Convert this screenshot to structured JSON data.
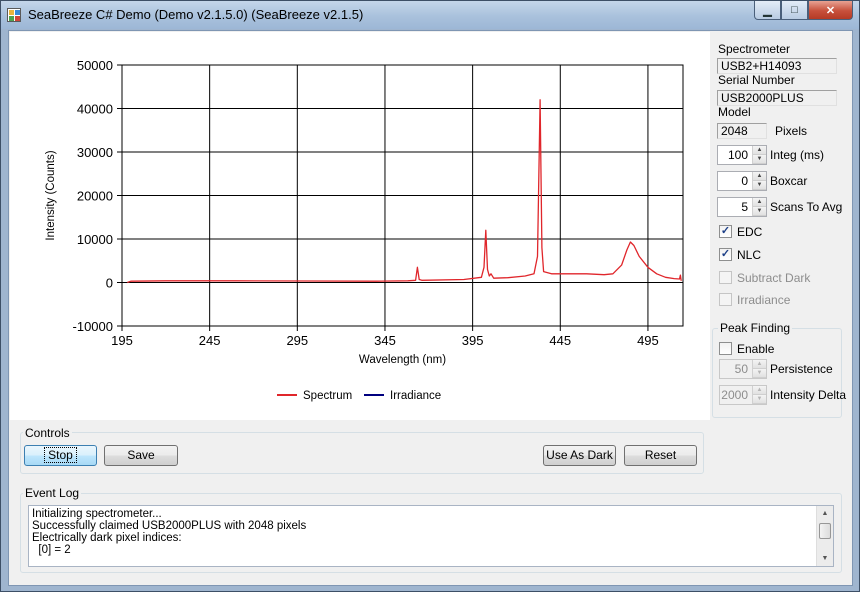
{
  "window": {
    "title": "SeaBreeze C# Demo (Demo v2.1.5.0) (SeaBreeze v2.1.5)",
    "minimize_glyph": "▁",
    "maximize_glyph": "□",
    "close_glyph": "✕"
  },
  "spectrometer": {
    "group_label": "Spectrometer",
    "serial_value": "USB2+H14093",
    "serial_label": "Serial Number",
    "model_value": "USB2000PLUS",
    "model_label": "Model",
    "pixels_value": "2048",
    "pixels_label": "Pixels",
    "integ_value": "100",
    "integ_label": "Integ (ms)",
    "boxcar_value": "0",
    "boxcar_label": "Boxcar",
    "scans_value": "5",
    "scans_label": "Scans To Avg",
    "edc_label": "EDC",
    "edc_checked": true,
    "nlc_label": "NLC",
    "nlc_checked": true,
    "subtract_dark_label": "Subtract Dark",
    "subtract_dark_checked": false,
    "irradiance_label": "Irradiance",
    "irradiance_checked": false
  },
  "peak_finding": {
    "group_label": "Peak Finding",
    "enable_label": "Enable",
    "enable_checked": false,
    "persistence_value": "50",
    "persistence_label": "Persistence",
    "intensity_delta_value": "2000",
    "intensity_delta_label": "Intensity Delta"
  },
  "controls": {
    "group_label": "Controls",
    "stop_label": "Stop",
    "save_label": "Save",
    "use_as_dark_label": "Use As Dark",
    "reset_label": "Reset"
  },
  "event_log": {
    "group_label": "Event Log",
    "lines": [
      "Initializing spectrometer...",
      "Successfully claimed USB2000PLUS with 2048 pixels",
      "Electrically dark pixel indices:",
      "  [0] = 2"
    ]
  },
  "chart_data": {
    "type": "line",
    "title": "",
    "xlabel": "Wavelength (nm)",
    "ylabel": "Intensity (Counts)",
    "xlim": [
      195,
      515
    ],
    "ylim": [
      -10000,
      50000
    ],
    "x_ticks": [
      195,
      245,
      295,
      345,
      395,
      445,
      495
    ],
    "y_ticks": [
      50000,
      40000,
      30000,
      20000,
      10000,
      0,
      -10000
    ],
    "grid": true,
    "legend_position": "bottom-center",
    "series": [
      {
        "name": "Spectrum",
        "color": "#e0262b",
        "points": [
          [
            198,
            0
          ],
          [
            200,
            300
          ],
          [
            220,
            400
          ],
          [
            260,
            400
          ],
          [
            300,
            350
          ],
          [
            340,
            300
          ],
          [
            358,
            400
          ],
          [
            362.5,
            500
          ],
          [
            363.5,
            3500
          ],
          [
            364.5,
            700
          ],
          [
            366,
            500
          ],
          [
            390,
            700
          ],
          [
            400,
            1200
          ],
          [
            401.5,
            3500
          ],
          [
            402.5,
            12000
          ],
          [
            403.5,
            3000
          ],
          [
            404.5,
            1500
          ],
          [
            405.5,
            2000
          ],
          [
            407,
            1000
          ],
          [
            415,
            1100
          ],
          [
            425,
            1500
          ],
          [
            430,
            2000
          ],
          [
            432,
            6000
          ],
          [
            433.5,
            42000
          ],
          [
            434.5,
            8000
          ],
          [
            435.5,
            2500
          ],
          [
            440,
            2000
          ],
          [
            460,
            2000
          ],
          [
            470,
            1800
          ],
          [
            475,
            2000
          ],
          [
            480,
            4000
          ],
          [
            483,
            7500
          ],
          [
            485,
            9300
          ],
          [
            487,
            8500
          ],
          [
            490,
            6000
          ],
          [
            495,
            3500
          ],
          [
            500,
            2000
          ],
          [
            505,
            1200
          ],
          [
            510,
            900
          ],
          [
            513,
            800
          ],
          [
            513.5,
            1700
          ],
          [
            514,
            400
          ]
        ]
      },
      {
        "name": "Irradiance",
        "color": "#00007f",
        "points": []
      }
    ]
  }
}
